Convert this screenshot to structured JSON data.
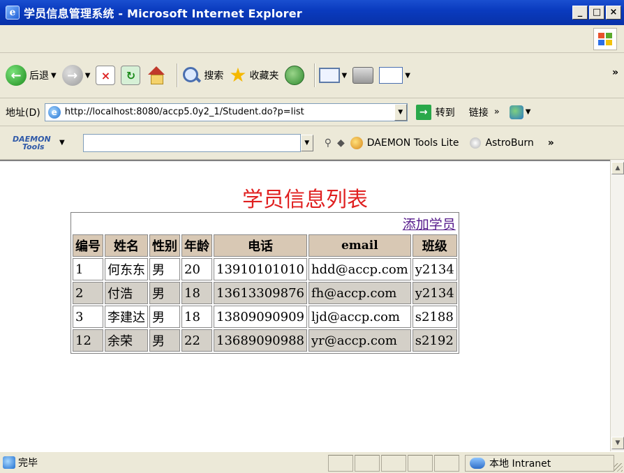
{
  "window": {
    "title": "学员信息管理系统 - Microsoft Internet Explorer",
    "controls": {
      "minimize": "_",
      "maximize": "□",
      "close": "×"
    }
  },
  "toolbar": {
    "back_label": "后退",
    "search_label": "搜索",
    "favorites_label": "收藏夹",
    "overflow": "»"
  },
  "address_bar": {
    "label": "地址(D)",
    "url": "http://localhost:8080/accp5.0y2_1/Student.do?p=list",
    "go_label": "转到",
    "links_label": "链接",
    "links_chevron": "»"
  },
  "daemon_bar": {
    "logo_line1": "DAEMON",
    "logo_line2": "Tools",
    "search_value": "",
    "daemon_tools_label": "DAEMON Tools Lite",
    "astroburn_label": "AstroBurn",
    "overflow": "»"
  },
  "page": {
    "heading": "学员信息列表",
    "add_link": "添加学员",
    "columns": [
      "编号",
      "姓名",
      "性别",
      "年龄",
      "电话",
      "email",
      "班级"
    ],
    "rows": [
      [
        "1",
        "何东东",
        "男",
        "20",
        "13910101010",
        "hdd@accp.com",
        "y2134"
      ],
      [
        "2",
        "付浩",
        "男",
        "18",
        "13613309876",
        "fh@accp.com",
        "y2134"
      ],
      [
        "3",
        "李建达",
        "男",
        "18",
        "13809090909",
        "ljd@accp.com",
        "s2188"
      ],
      [
        "12",
        "余荣",
        "男",
        "22",
        "13689090988",
        "yr@accp.com",
        "s2192"
      ]
    ]
  },
  "status_bar": {
    "status": "完毕",
    "zone": "本地 Intranet"
  },
  "colors": {
    "heading": "#e02020",
    "header_bg": "#d8c8b4",
    "alt_row_bg": "#d4d0c8",
    "titlebar": "#0a3bbf"
  }
}
